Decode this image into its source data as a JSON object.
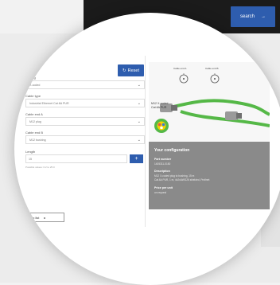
{
  "background": {
    "search_label": "search",
    "search_arrow": "→"
  },
  "configurator": {
    "title": "onfiguration",
    "reset_label": "Reset",
    "fields": [
      {
        "label": "Coding",
        "value": "X-coded"
      },
      {
        "label": "Cable type",
        "value": "Industrial Ethernet Cat.6A PUR"
      },
      {
        "label": "Cable end A",
        "value": "M12 plug"
      },
      {
        "label": "Cable end B",
        "value": "M12 bushing"
      }
    ],
    "length_label": "Length",
    "length_value": "15",
    "plus_label": "+",
    "hint": "Possible values: 0.2 to 25.0",
    "pager_text": "to list",
    "pager_arrow": "▸"
  },
  "product": {
    "name_line1": "M12 X-coded",
    "name_line2": "Cat.6A PUR",
    "caption_left": "Cable end A",
    "caption_right": "Cable end B"
  },
  "your_configuration": {
    "heading": "Your configuration",
    "part_label": "Part number",
    "part_value": "1405311-0150",
    "desc_label": "Description",
    "desc_value1": "M12 X-coded plug to bushing, 15 m",
    "desc_value2": "Cat.6A PUR, 1 m, 4x2xAWG26 shielded, Profinet",
    "price_label": "Price per unit",
    "price_value": "on request"
  },
  "colors": {
    "accent": "#2e5dae",
    "cable": "#55b847",
    "summary_bg": "#8a8a8a"
  }
}
